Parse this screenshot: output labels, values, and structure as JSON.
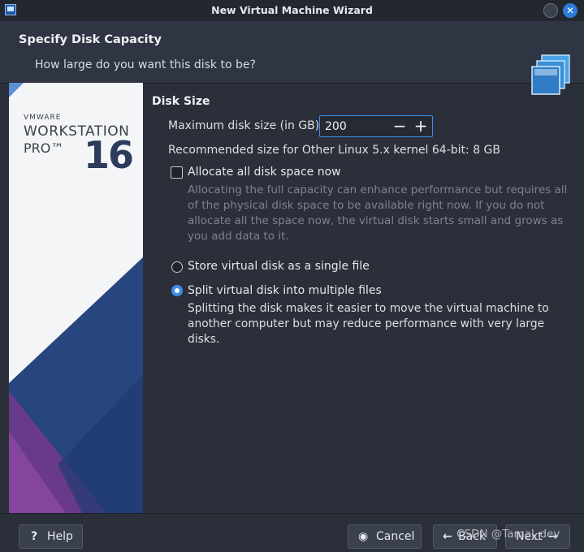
{
  "window": {
    "title": "New Virtual Machine Wizard",
    "close_glyph": "✕"
  },
  "header": {
    "title": "Specify Disk Capacity",
    "subtitle": "How large do you want this disk to be?",
    "icon": "disk-stack-icon"
  },
  "banner": {
    "brand": "VMWARE",
    "product": "WORKSTATION",
    "edition": "PRO™",
    "version": "16"
  },
  "disk_size": {
    "section_title": "Disk Size",
    "max_label": "Maximum disk size (in GB):",
    "value": "200",
    "minus": "−",
    "plus": "+",
    "recommended": "Recommended size for Other Linux 5.x kernel 64-bit: 8 GB"
  },
  "allocate": {
    "label": "Allocate all disk space now",
    "checked": false,
    "description": "Allocating the full capacity can enhance performance but requires all of the physical disk space to be available right now. If you do not allocate all the space now, the virtual disk starts small and grows as you add data to it."
  },
  "storage_options": {
    "single": {
      "label": "Store virtual disk as a single file",
      "selected": false
    },
    "split": {
      "label": "Split virtual disk into multiple files",
      "selected": true,
      "description": "Splitting the disk makes it easier to move the virtual machine to another computer but may reduce performance with very large disks."
    }
  },
  "footer": {
    "help": {
      "icon": "?",
      "label": "Help"
    },
    "cancel": {
      "icon": "◉",
      "label": "Cancel"
    },
    "back": {
      "icon": "←",
      "label": "Back"
    },
    "next": {
      "icon": "→",
      "label": "Next"
    }
  },
  "watermark": "CSDN @Tamal_dev",
  "colors": {
    "accent": "#3b8eea",
    "background": "#2a2f3a",
    "banner_blue": "#2c3a5c",
    "banner_purple": "#6a3a8a"
  }
}
